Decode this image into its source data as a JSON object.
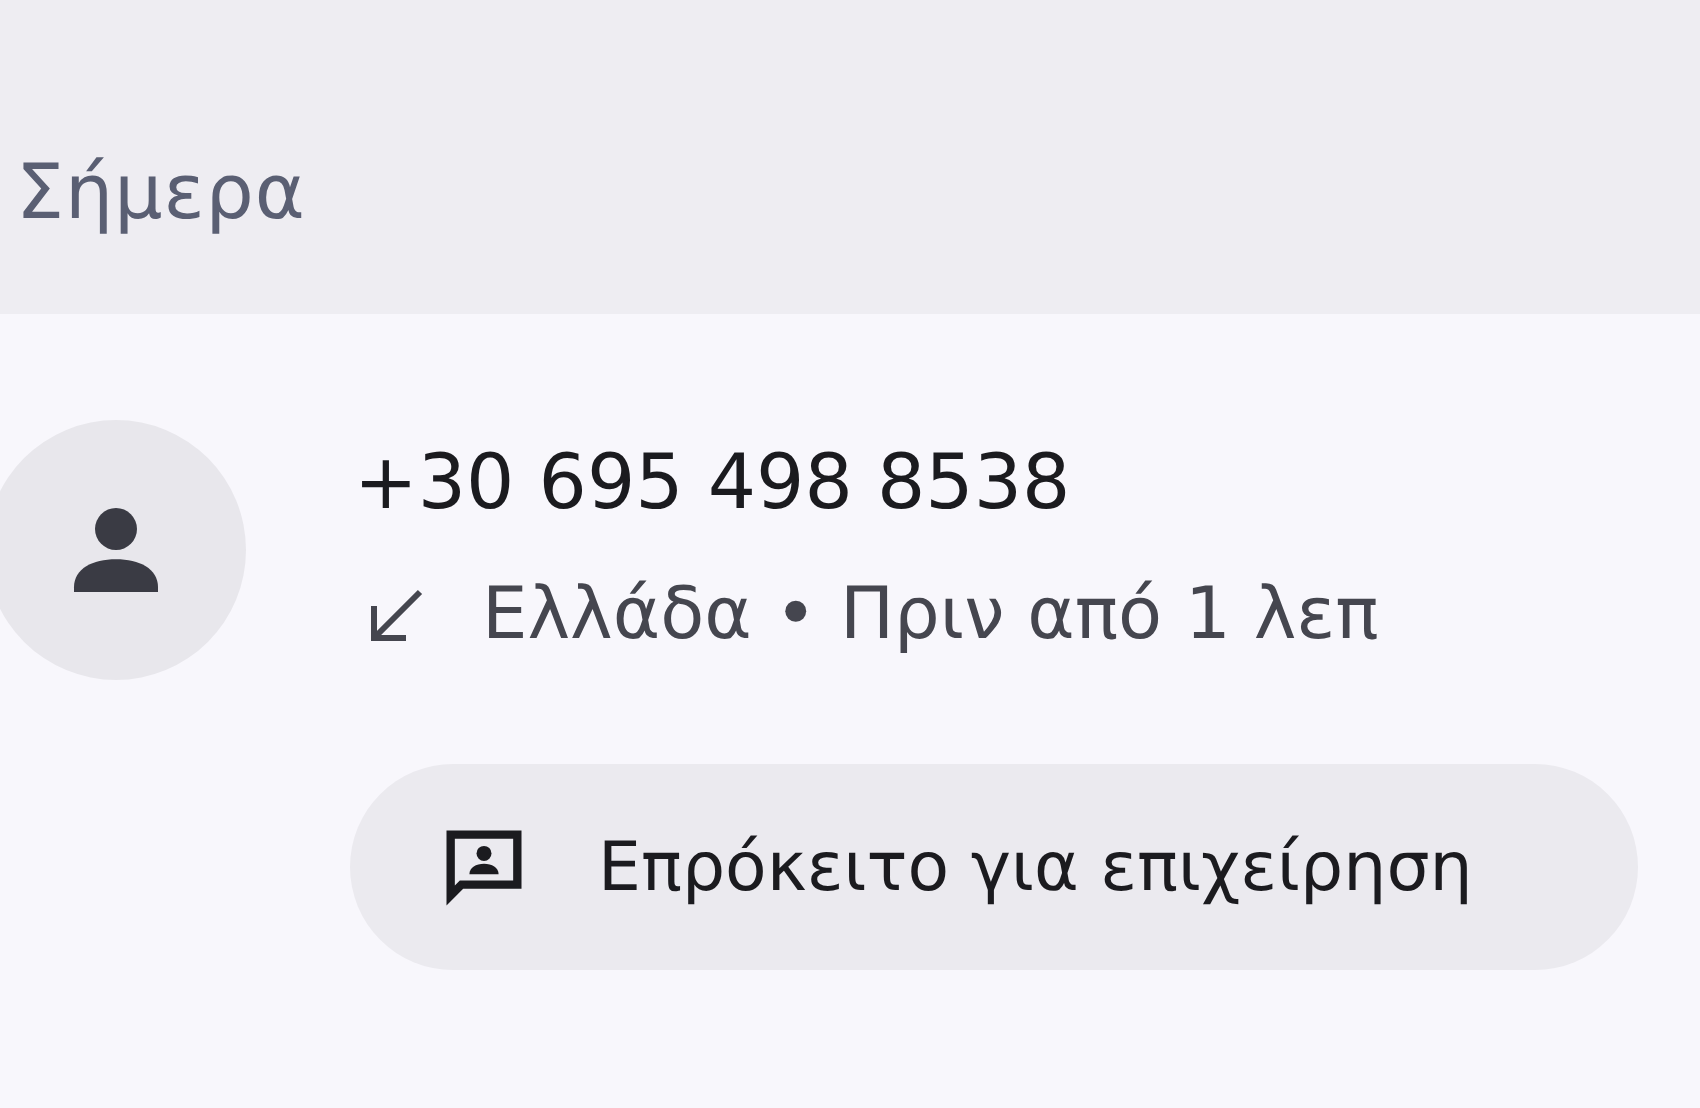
{
  "section_header": "Σήμερα",
  "call": {
    "number": "+30 695 498 8538",
    "incoming": true,
    "details": "Ελλάδα • Πριν από 1 λεπ",
    "chip": {
      "label": "Επρόκειτο για επιχείρηση"
    }
  }
}
